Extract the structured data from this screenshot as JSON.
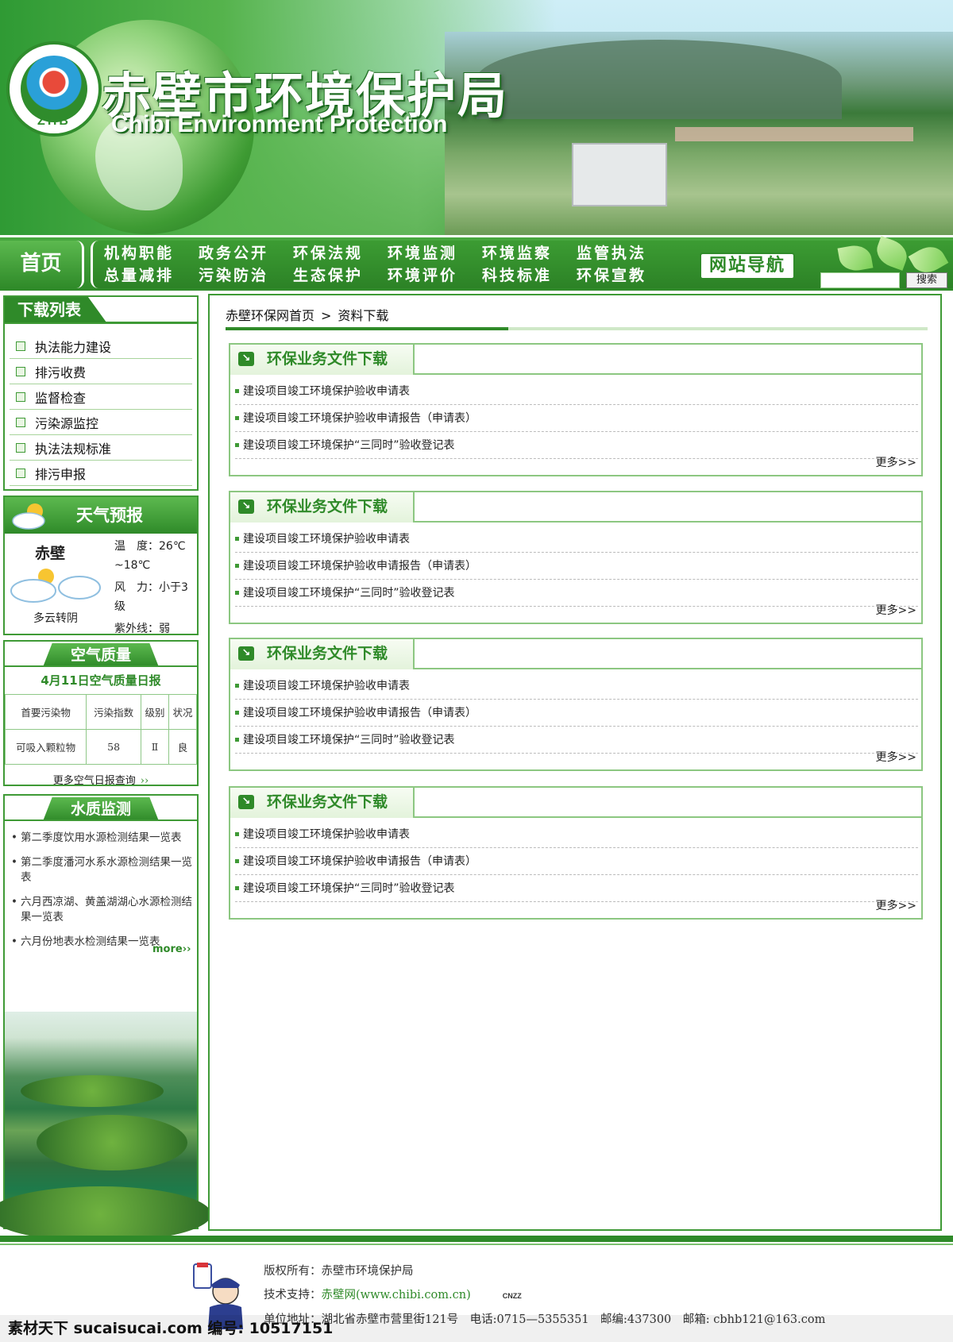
{
  "header": {
    "logo_code": "ZHB",
    "title": "赤壁市环境保护局",
    "subtitle": "Chibi Environment Protection"
  },
  "nav": {
    "home": "首页",
    "items": [
      "机构职能",
      "政务公开",
      "环保法规",
      "环境监测",
      "环境监察",
      "监管执法",
      "总量减排",
      "污染防治",
      "生态保护",
      "环境评价",
      "科技标准",
      "环保宣教"
    ],
    "sitemap": "网站导航",
    "search_button": "搜索",
    "search_value": ""
  },
  "sidebar": {
    "download_title": "下载列表",
    "download_items": [
      "执法能力建设",
      "排污收费",
      "监督检查",
      "污染源监控",
      "执法法规标准",
      "排污申报"
    ],
    "weather": {
      "title": "天气预报",
      "city": "赤壁",
      "condition": "多云转阴",
      "temp_label": "温　度：",
      "temp": "26℃ ~18℃",
      "wind_label": "风　力：",
      "wind": "小于3级",
      "uv_label": "紫外线：",
      "uv": "弱"
    },
    "air": {
      "title": "空气质量",
      "date": "4月11日空气质量日报",
      "headers": [
        "首要污染物",
        "污染指数",
        "级别",
        "状况"
      ],
      "row": [
        "可吸入颗粒物",
        "58",
        "Ⅱ",
        "良"
      ],
      "more": "更多空气日报查询",
      "more_arrow": "››"
    },
    "water": {
      "title": "水质监测",
      "items": [
        "第二季度饮用水源检测结果一览表",
        "第二季度潘河水系水源检测结果一览表",
        "六月西凉湖、黄盖湖湖心水源检测结果一览表",
        "六月份地表水检测结果一览表"
      ],
      "more": "more››"
    }
  },
  "breadcrumb": {
    "home": "赤壁环保网首页",
    "sep": ">",
    "current": "资料下载"
  },
  "panels": [
    {
      "title": "环保业务文件下载",
      "items": [
        "建设项目竣工环境保护验收申请表",
        "建设项目竣工环境保护验收申请报告（申请表）",
        "建设项目竣工环境保护“三同时”验收登记表"
      ],
      "more": "更多>>"
    },
    {
      "title": "环保业务文件下载",
      "items": [
        "建设项目竣工环境保护验收申请表",
        "建设项目竣工环境保护验收申请报告（申请表）",
        "建设项目竣工环境保护“三同时”验收登记表"
      ],
      "more": "更多>>"
    },
    {
      "title": "环保业务文件下载",
      "items": [
        "建设项目竣工环境保护验收申请表",
        "建设项目竣工环境保护验收申请报告（申请表）",
        "建设项目竣工环境保护“三同时”验收登记表"
      ],
      "more": "更多>>"
    },
    {
      "title": "环保业务文件下载",
      "items": [
        "建设项目竣工环境保护验收申请表",
        "建设项目竣工环境保护验收申请报告（申请表）",
        "建设项目竣工环境保护“三同时”验收登记表"
      ],
      "more": "更多>>"
    }
  ],
  "footer": {
    "copyright_label": "版权所有：",
    "copyright": "赤壁市环境保护局",
    "tech_label": "技术支持：",
    "tech": "赤壁网(www.chibi.com.cn)",
    "cnzz": "CNZZ",
    "address": "单位地址：湖北省赤壁市营里街121号　电话:0715—5355351　邮编:437300　邮箱: cbhb121@163.com"
  },
  "watermark": "素材天下 sucaisucai.com  编号: 10517151",
  "colors": {
    "primary_green": "#2f8a29",
    "light_green": "#8cc781"
  }
}
